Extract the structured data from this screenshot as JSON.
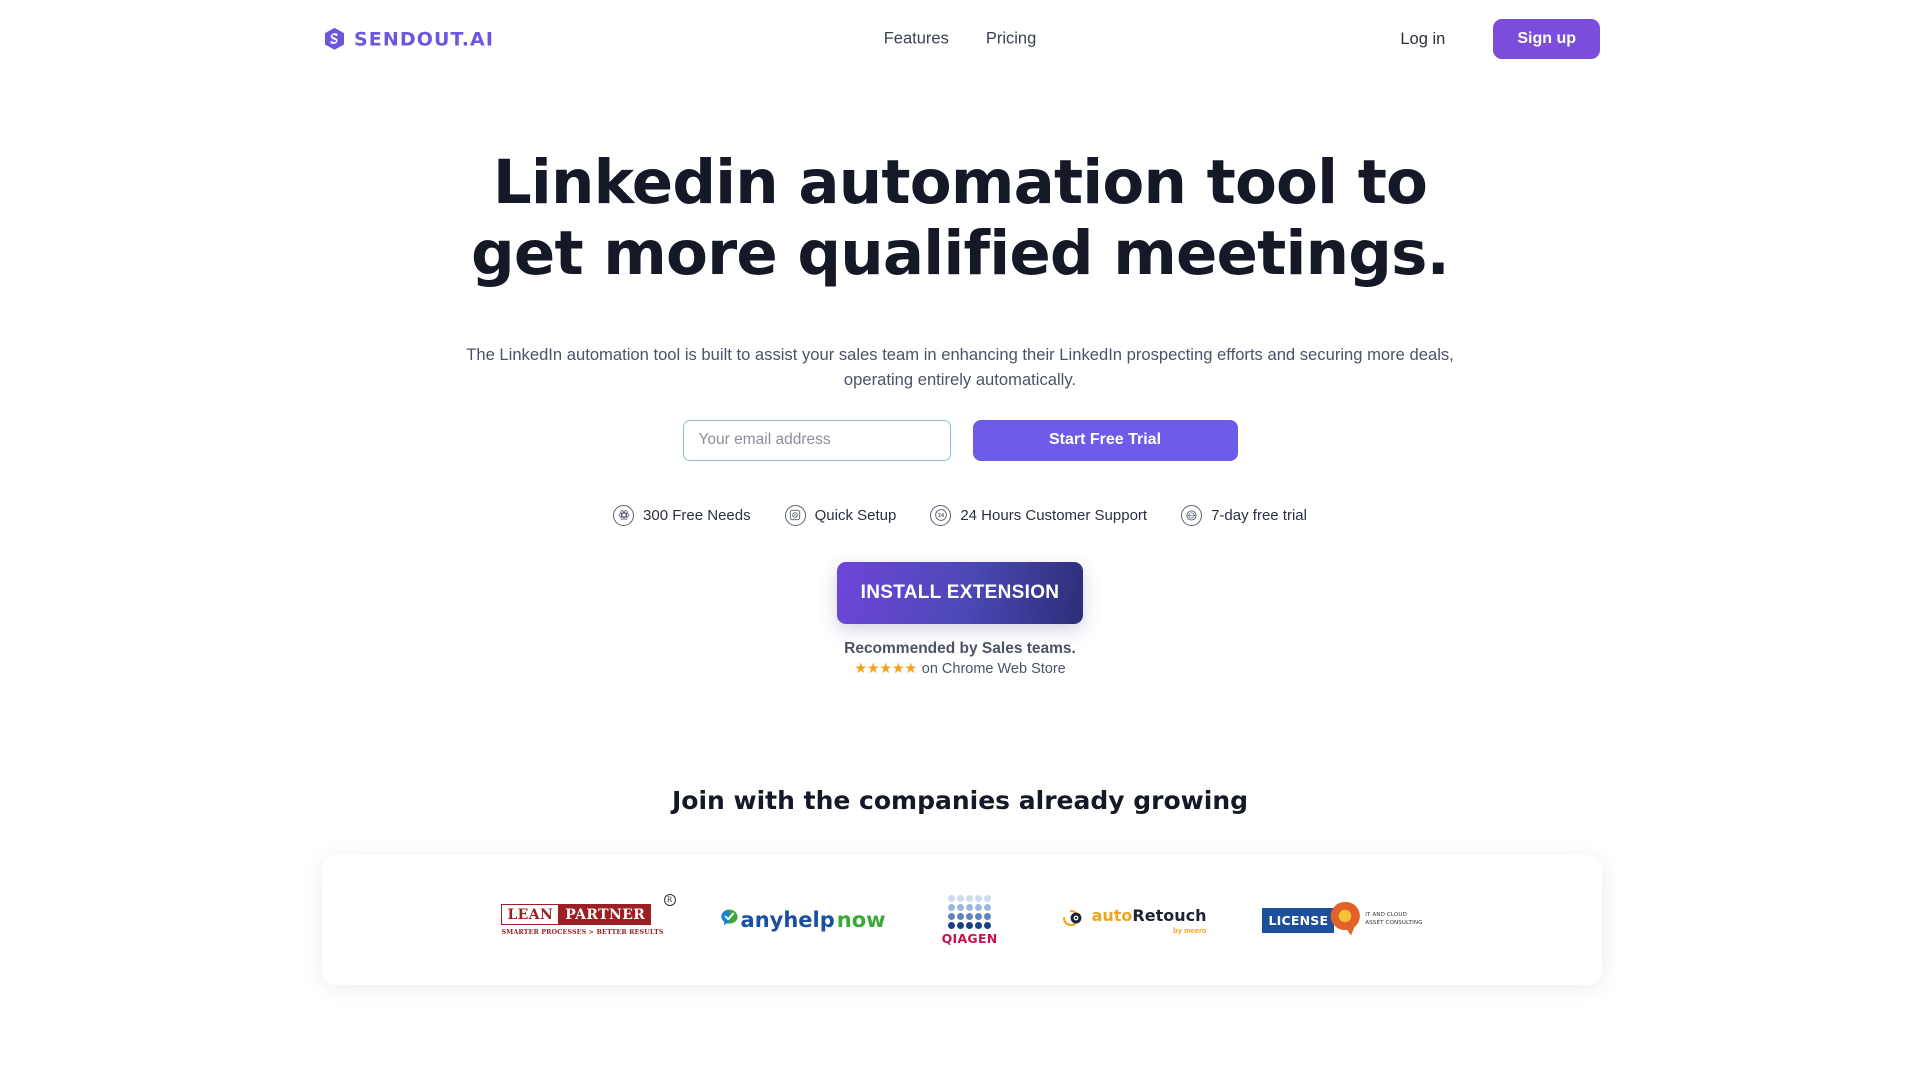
{
  "brand": {
    "name": "SENDOUT.AI",
    "logo_icon": "hexagon-swoosh-icon",
    "color": "#6c55e0"
  },
  "header": {
    "nav": [
      {
        "label": "Features"
      },
      {
        "label": "Pricing"
      }
    ],
    "login_label": "Log in",
    "signup_label": "Sign up",
    "signup_color": "#7c4ddb"
  },
  "hero": {
    "title": "Linkedin automation tool to get more qualified meetings.",
    "subtitle": "The LinkedIn automation tool is built to assist your sales team in enhancing their LinkedIn prospecting efforts and securing more deals, operating entirely automatically.",
    "email_placeholder": "Your email address",
    "email_value": "",
    "cta_label": "Start Free Trial",
    "cta_color": "#6c5ce7"
  },
  "badges": [
    {
      "label": "300 Free Needs",
      "icon": "settings-gear-icon"
    },
    {
      "label": "Quick Setup",
      "icon": "target-icon"
    },
    {
      "label": "24 Hours Customer Support",
      "icon": "clock-24-icon"
    },
    {
      "label": "7-day free trial",
      "icon": "seal-badge-icon"
    }
  ],
  "install": {
    "button_label": "INSTALL EXTENSION",
    "gradient_from": "#6e46d8",
    "gradient_to": "#2c2e76",
    "recommend_text": "Recommended by Sales teams.",
    "stars": "★★★★★",
    "star_color": "#f2a51a",
    "store_text": "on Chrome Web Store"
  },
  "companies": {
    "title": "Join with the companies already growing",
    "logos": [
      {
        "name": "Lean Partner",
        "word_one": "LEAN",
        "word_two": "PARTNER",
        "registered": "R",
        "tagline": "SMARTER PROCESSES > BETTER RESULTS",
        "color": "#9c1f23"
      },
      {
        "name": "anyhelpnow",
        "part_one": "anyhelp",
        "part_two": "now",
        "icon": "check-bubble-icon",
        "color_one": "#1b4fa0",
        "color_two": "#3da83a"
      },
      {
        "name": "QIAGEN",
        "wordmark": "QIAGEN",
        "color": "#c8104a"
      },
      {
        "name": "autoRetouch",
        "part_one": "auto",
        "part_two": "Retouch",
        "sub": "by meero",
        "icon": "aperture-icon",
        "color": "#f2a51a"
      },
      {
        "name": "LICENSE Q",
        "word": "LICENSE",
        "tagline_line_one": "IT AND CLOUD",
        "tagline_line_two": "ASSET CONSULTING",
        "color": "#1d4f9c",
        "accent": "#e2622c"
      }
    ]
  }
}
